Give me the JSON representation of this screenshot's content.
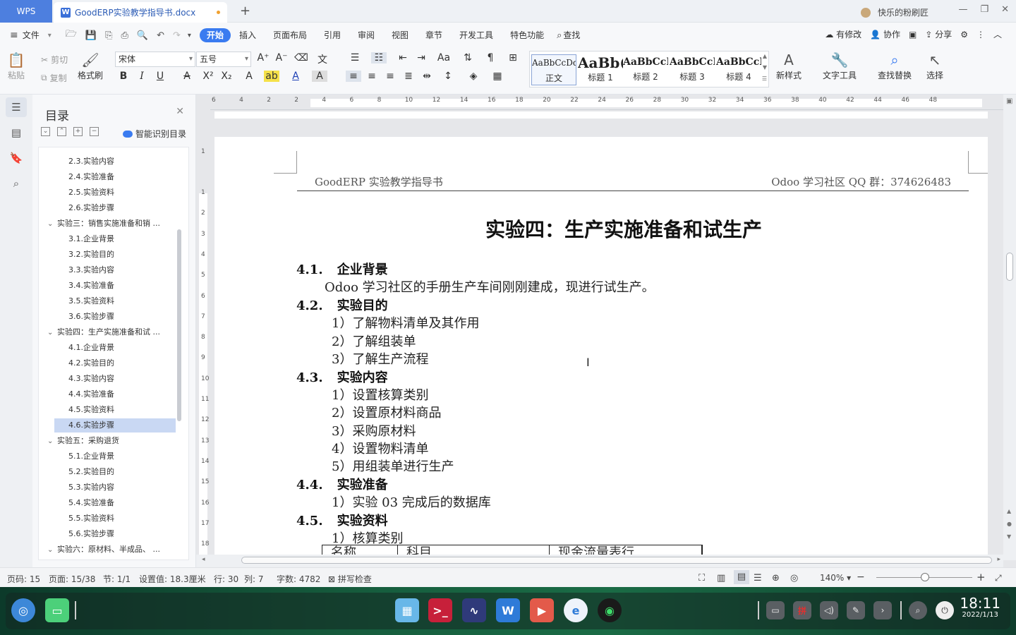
{
  "titlebar": {
    "wps_label": "WPS",
    "doc_tab": "GoodERP实验教学指导书.docx",
    "user": "快乐的粉刷匠"
  },
  "menubar": {
    "file": "文件",
    "tabs": [
      "开始",
      "插入",
      "页面布局",
      "引用",
      "审阅",
      "视图",
      "章节",
      "开发工具",
      "特色功能"
    ],
    "search": "查找",
    "right": [
      "有修改",
      "协作",
      "分享"
    ]
  },
  "ribbon": {
    "paste": "粘贴",
    "cut": "剪切",
    "copy": "复制",
    "format_painter": "格式刷",
    "font_name": "宋体",
    "font_size": "五号",
    "styles": [
      {
        "preview": "AaBbCcDd",
        "name": "正文"
      },
      {
        "preview": "AaBb(",
        "name": "标题 1"
      },
      {
        "preview": "AaBbCcI",
        "name": "标题 2"
      },
      {
        "preview": "AaBbCcI",
        "name": "标题 3"
      },
      {
        "preview": "AaBbCcI",
        "name": "标题 4"
      }
    ],
    "new_style": "新样式",
    "text_tools": "文字工具",
    "find_replace": "查找替换",
    "select": "选择"
  },
  "nav": {
    "title": "目录",
    "smart": "智能识别目录",
    "items": [
      {
        "text": "2.3.实验内容",
        "level": 2
      },
      {
        "text": "2.4.实验准备",
        "level": 2
      },
      {
        "text": "2.5.实验资料",
        "level": 2
      },
      {
        "text": "2.6.实验步骤",
        "level": 2
      },
      {
        "text": "实验三：销售实施准备和销 ...",
        "level": 1
      },
      {
        "text": "3.1.企业背景",
        "level": 2
      },
      {
        "text": "3.2.实验目的",
        "level": 2
      },
      {
        "text": "3.3.实验内容",
        "level": 2
      },
      {
        "text": "3.4.实验准备",
        "level": 2
      },
      {
        "text": "3.5.实验资料",
        "level": 2
      },
      {
        "text": "3.6.实验步骤",
        "level": 2
      },
      {
        "text": "实验四：生产实施准备和试 ...",
        "level": 1
      },
      {
        "text": "4.1.企业背景",
        "level": 2
      },
      {
        "text": "4.2.实验目的",
        "level": 2
      },
      {
        "text": "4.3.实验内容",
        "level": 2
      },
      {
        "text": "4.4.实验准备",
        "level": 2
      },
      {
        "text": "4.5.实验资料",
        "level": 2
      },
      {
        "text": "4.6.实验步骤",
        "level": 2,
        "selected": true
      },
      {
        "text": "实验五：采购退货",
        "level": 1
      },
      {
        "text": "5.1.企业背景",
        "level": 2
      },
      {
        "text": "5.2.实验目的",
        "level": 2
      },
      {
        "text": "5.3.实验内容",
        "level": 2
      },
      {
        "text": "5.4.实验准备",
        "level": 2
      },
      {
        "text": "5.5.实验资料",
        "level": 2
      },
      {
        "text": "5.6.实验步骤",
        "level": 2
      },
      {
        "text": "实验六：原材料、半成品、 ...",
        "level": 1
      }
    ]
  },
  "ruler": {
    "h_ticks": [
      "6",
      "4",
      "2",
      "2",
      "4",
      "6",
      "8",
      "10",
      "12",
      "14",
      "16",
      "18",
      "20",
      "22",
      "24",
      "26",
      "28",
      "30",
      "32",
      "34",
      "36",
      "38",
      "40",
      "42",
      "44",
      "46",
      "48"
    ],
    "v_ticks": [
      "1",
      "1",
      "2",
      "3",
      "4",
      "5",
      "6",
      "7",
      "8",
      "9",
      "10",
      "11",
      "12",
      "13",
      "14",
      "15",
      "16",
      "17",
      "18"
    ]
  },
  "document": {
    "header_left": "GoodERP 实验教学指导书",
    "header_right": "Odoo 学习社区 QQ 群：374626483",
    "title": "实验四：生产实施准备和试生产",
    "s1_num": "4.1.",
    "s1_title": "企业背景",
    "s1_body": "Odoo 学习社区的手册生产车间刚刚建成，现进行试生产。",
    "s2_num": "4.2.",
    "s2_title": "实验目的",
    "s2_items": [
      "1）了解物料清单及其作用",
      "2）了解组装单",
      "3）了解生产流程"
    ],
    "s3_num": "4.3.",
    "s3_title": "实验内容",
    "s3_items": [
      "1）设置核算类别",
      "2）设置原材料商品",
      "3）采购原材料",
      "4）设置物料清单",
      "5）用组装单进行生产"
    ],
    "s4_num": "4.4.",
    "s4_title": "实验准备",
    "s4_items": [
      "1）实验 03 完成后的数据库"
    ],
    "s5_num": "4.5.",
    "s5_title": "实验资料",
    "s5_items": [
      "1）核算类别"
    ],
    "table_headers": [
      "名称",
      "科目",
      "现金流量表行"
    ]
  },
  "status": {
    "page_code": "页码: 15",
    "pages": "页面: 15/38",
    "section": "节: 1/1",
    "setting": "设置值: 18.3厘米",
    "row": "行: 30",
    "col": "列: 7",
    "words": "字数: 4782",
    "spell": "拼写检查",
    "zoom": "140%"
  },
  "clock": {
    "time": "18:11",
    "date": "2022/1/13"
  },
  "colors": {
    "accent": "#3a7bf0",
    "wps_tab": "#4d7fdf",
    "toc_selected": "#c9d8f3"
  }
}
